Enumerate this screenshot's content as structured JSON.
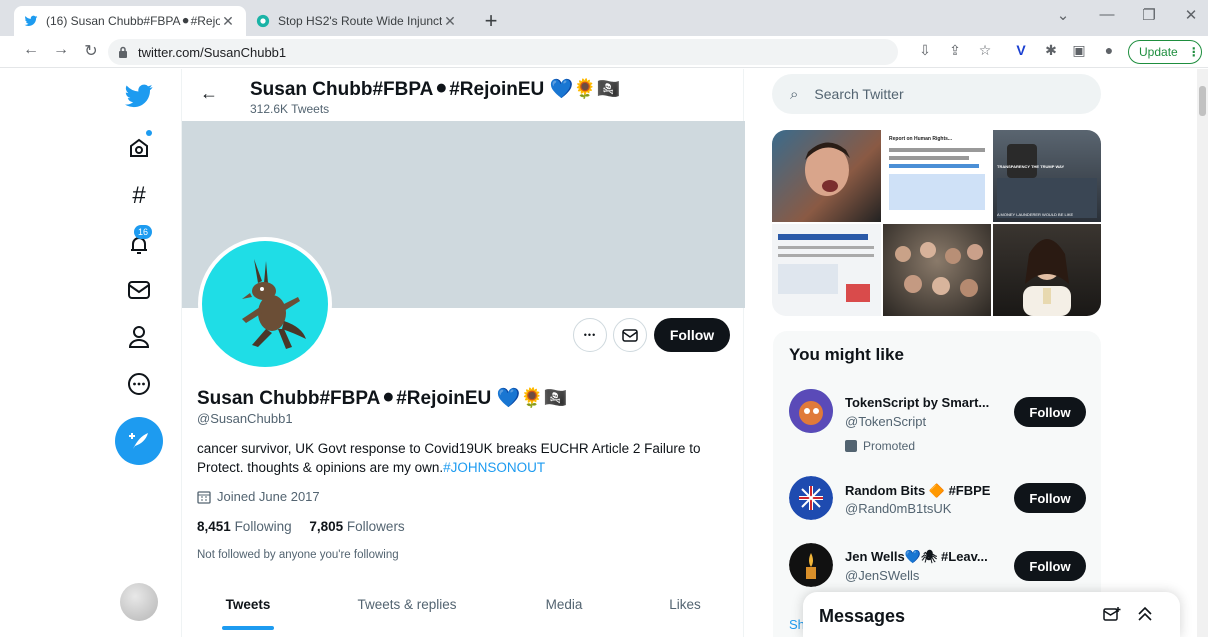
{
  "browser": {
    "tabs": [
      {
        "title": "(16) Susan Chubb#FBPA⚫#Rejo",
        "close": "✕"
      },
      {
        "title": "Stop HS2's Route Wide Injunctio",
        "close": "✕"
      }
    ],
    "new_tab": "+",
    "url": "twitter.com/SusanChubb1",
    "update_label": "Update",
    "update_more": "⋮"
  },
  "header": {
    "name": "Susan Chubb#FBPA⚫#RejoinEU 💙🌻🏴‍☠️",
    "tweet_count": "312.6K Tweets"
  },
  "profile": {
    "name": "Susan Chubb#FBPA⚫#RejoinEU 💙🌻🏴‍☠️",
    "handle": "@SusanChubb1",
    "bio_text": "cancer survivor, UK Govt response to Covid19UK breaks EUCHR Article 2 Failure to Protect. thoughts & opinions are my own.",
    "bio_hashtag": "#JOHNSONOUT",
    "joined": "Joined June 2017",
    "following_count": "8,451",
    "following_label": "Following",
    "followers_count": "7,805",
    "followers_label": "Followers",
    "not_followed": "Not followed by anyone you're following",
    "follow_label": "Follow",
    "more_glyph": "•••"
  },
  "profile_tabs": [
    "Tweets",
    "Tweets & replies",
    "Media",
    "Likes"
  ],
  "nav": {
    "notifications_count": "16"
  },
  "search": {
    "placeholder": "Search Twitter"
  },
  "media_tiles": {
    "doc_title": "Report on Human Rights...",
    "doc_caption_1": "COMMITTEE ON HUMAN RIGHTS",
    "tile3_caption": "TRANSPARENCY THE TRUMP WAY",
    "tile4_caption": "A MONEY LAUNDERER WOULD BE LIKE"
  },
  "who_to_follow": {
    "title": "You might like",
    "promoted_label": "Promoted",
    "follow_label": "Follow",
    "show_more": "Sh",
    "accounts": [
      {
        "name": "TokenScript by Smart...",
        "handle": "@TokenScript"
      },
      {
        "name": "Random Bits 🔶 #FBPE",
        "handle": "@Rand0mB1tsUK"
      },
      {
        "name": "Jen Wells💙🕷 #Leav...",
        "handle": "@JenSWells"
      }
    ]
  },
  "messages": {
    "title": "Messages"
  }
}
